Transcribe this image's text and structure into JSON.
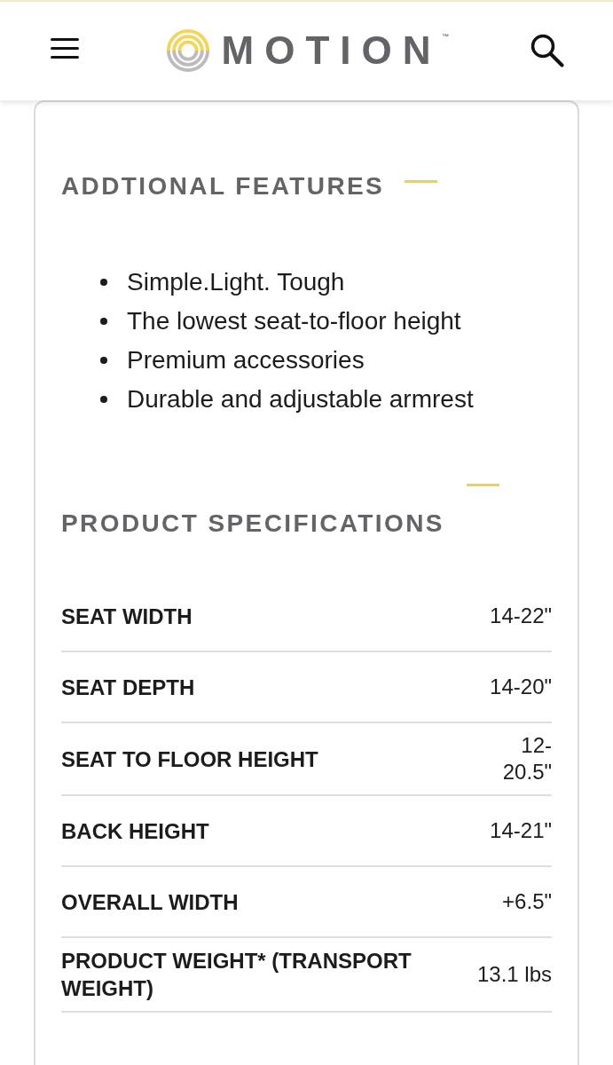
{
  "header": {
    "logo": {
      "wordmark": "MOTION",
      "trademark": "™"
    }
  },
  "sections": [
    {
      "kind": "list",
      "title": "ADDTIONAL FEATURES",
      "items": [
        "Simple.Light. Tough",
        "The lowest seat-to-floor height",
        "Premium accessories",
        "Durable and adjustable armrest"
      ]
    },
    {
      "kind": "specs",
      "title": "PRODUCT SPECIFICATIONS",
      "rows": [
        {
          "label": "SEAT WIDTH",
          "value": "14-22\""
        },
        {
          "label": "SEAT DEPTH",
          "value": "14-20\""
        },
        {
          "label": "SEAT TO FLOOR HEIGHT",
          "value": "12-20.5\""
        },
        {
          "label": "BACK HEIGHT",
          "value": "14-21\""
        },
        {
          "label": "OVERALL WIDTH",
          "value": "+6.5\""
        },
        {
          "label": "PRODUCT WEIGHT* (TRANSPORT WEIGHT)",
          "value": "13.1 lbs"
        }
      ]
    }
  ]
}
